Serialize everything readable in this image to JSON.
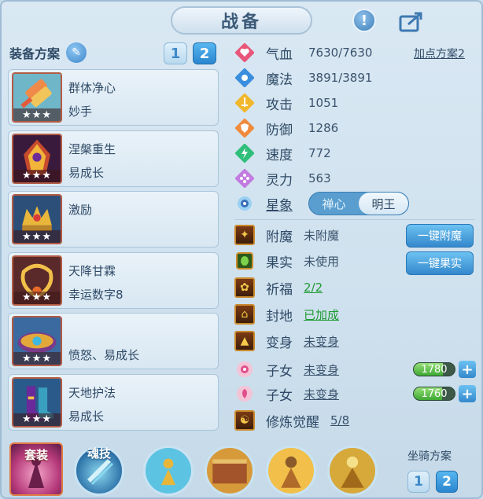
{
  "title": "战备",
  "equip_plan": {
    "label": "装备方案",
    "tabs": [
      "1",
      "2"
    ],
    "active_tab": "2"
  },
  "equipment": [
    {
      "name": "群体净心",
      "sub": "妙手",
      "stars": "★★★"
    },
    {
      "name": "涅槃重生",
      "sub": "易成长",
      "stars": "★★★"
    },
    {
      "name": "激励",
      "sub": "",
      "stars": "★★★"
    },
    {
      "name": "天降甘霖",
      "sub": "幸运数字8",
      "stars": "★★★"
    },
    {
      "name": "",
      "sub": "愤怒、易成长",
      "stars": "★★★"
    },
    {
      "name": "天地护法",
      "sub": "易成长",
      "stars": "★★★"
    }
  ],
  "stats": [
    {
      "label": "气血",
      "value": "7630/7630",
      "icon": "heart-icon",
      "color": "#e8567a"
    },
    {
      "label": "魔法",
      "value": "3891/3891",
      "icon": "mana-icon",
      "color": "#3a8ede"
    },
    {
      "label": "攻击",
      "value": "1051",
      "icon": "sword-icon",
      "color": "#f1b72c"
    },
    {
      "label": "防御",
      "value": "1286",
      "icon": "shield-icon",
      "color": "#f08a3c"
    },
    {
      "label": "速度",
      "value": "772",
      "icon": "lightning-icon",
      "color": "#2fbf7a"
    },
    {
      "label": "灵力",
      "value": "563",
      "icon": "spirit-icon",
      "color": "#c27be0"
    }
  ],
  "add_point_plan": "加点方案2",
  "star_sign": {
    "label": "星象",
    "options": [
      "禅心",
      "明王"
    ],
    "selected": "明王"
  },
  "buffs": [
    {
      "label": "附魔",
      "value": "未附魔",
      "style": "plain",
      "button": "一键附魔"
    },
    {
      "label": "果实",
      "value": "未使用",
      "style": "plain",
      "button": "一键果实"
    },
    {
      "label": "祈福",
      "value": "2/2",
      "style": "green"
    },
    {
      "label": "封地",
      "value": "已加成",
      "style": "green"
    },
    {
      "label": "变身",
      "value": "未变身",
      "style": "link"
    },
    {
      "label": "子女",
      "value": "未变身",
      "style": "link",
      "progress_label": "1780",
      "progress": 0.72
    },
    {
      "label": "子女",
      "value": "未变身",
      "style": "link",
      "progress_label": "1760",
      "progress": 0.7
    },
    {
      "label": "修炼觉醒",
      "value": "5/8",
      "style": "link"
    }
  ],
  "bottom": {
    "suit_label": "套装",
    "soul_label": "魂技",
    "mount_plan_label": "坐骑方案",
    "mount_tabs": [
      "1",
      "2"
    ],
    "mount_active_tab": "2"
  }
}
